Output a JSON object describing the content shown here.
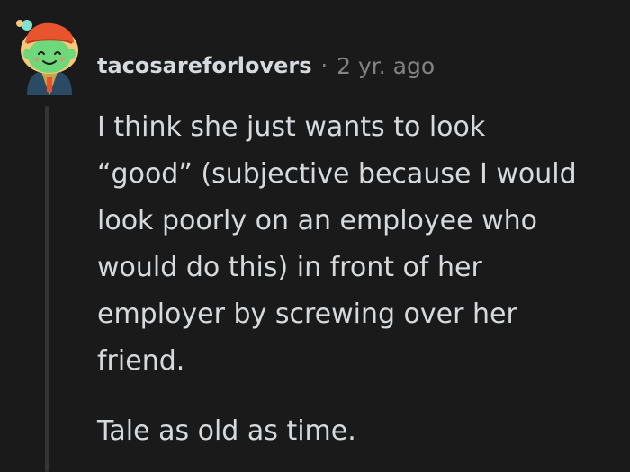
{
  "comment": {
    "author": "tacosareforlovers",
    "separator": "·",
    "timestamp": "2 yr. ago",
    "body": {
      "paragraph_1": "I think she just wants to look\n“good” (subjective because I would\nlook poorly on an employee who\nwould do this) in front of her\nemployer by screwing over her\nfriend.",
      "paragraph_2": "Tale as old as time."
    }
  },
  "colors": {
    "background": "#1a1a1b",
    "text": "#d7dadc",
    "meta_text": "#818384",
    "thread_line": "#343536",
    "avatar_skin": "#6fd87a",
    "avatar_hat": "#e8542e",
    "avatar_hair": "#f4c97b"
  },
  "icons": {
    "avatar": "snoo-avatar-icon"
  }
}
